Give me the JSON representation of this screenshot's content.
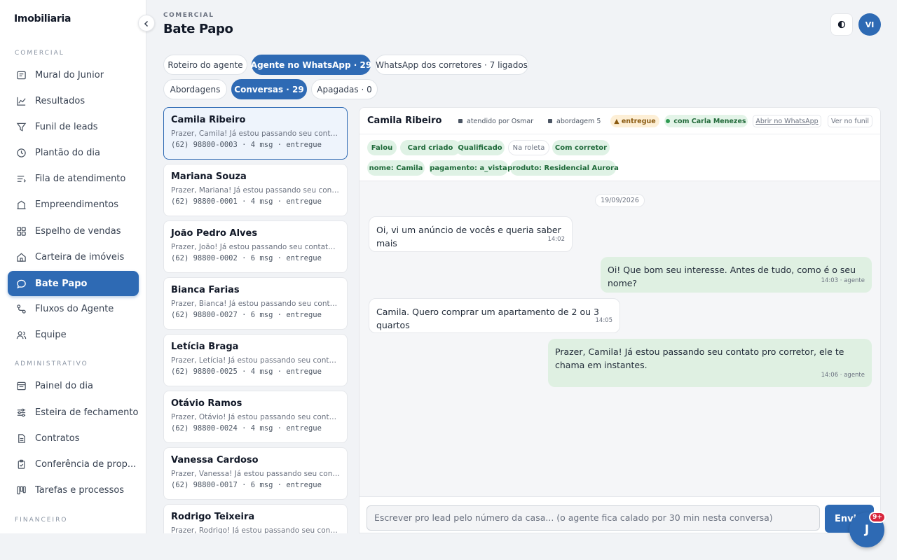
{
  "sidebar": {
    "brand": "Imobiliaria",
    "sections": {
      "comercial": "COMERCIAL",
      "administrativo": "ADMINISTRATIVO",
      "financeiro": "FINANCEIRO"
    },
    "items": [
      {
        "label": "Mural do Junior",
        "icon": "board-icon"
      },
      {
        "label": "Resultados",
        "icon": "chart-line-icon"
      },
      {
        "label": "Funil de leads",
        "icon": "funnel-icon"
      },
      {
        "label": "Plantão do dia",
        "icon": "clock-icon"
      },
      {
        "label": "Fila de atendimento",
        "icon": "queue-icon"
      },
      {
        "label": "Empreendimentos",
        "icon": "building-icon"
      },
      {
        "label": "Espelho de vendas",
        "icon": "grid-icon"
      },
      {
        "label": "Carteira de imóveis",
        "icon": "house-icon"
      },
      {
        "label": "Bate Papo",
        "icon": "chat-bubble-icon",
        "active": true
      },
      {
        "label": "Fluxos do Agente",
        "icon": "flow-icon"
      },
      {
        "label": "Equipe",
        "icon": "users-icon"
      },
      {
        "label": "Painel do dia",
        "icon": "panel-icon"
      },
      {
        "label": "Esteira de fechamento",
        "icon": "sliders-icon"
      },
      {
        "label": "Contratos",
        "icon": "document-icon"
      },
      {
        "label": "Conferência de prop...",
        "icon": "clipboard-check-icon"
      },
      {
        "label": "Tarefas e processos",
        "icon": "kanban-icon"
      }
    ]
  },
  "header": {
    "eyebrow": "COMERCIAL",
    "title": "Bate Papo",
    "avatar": "VI"
  },
  "tabs_top": [
    {
      "label": "Roteiro do agente"
    },
    {
      "label": "Agente no WhatsApp · 29",
      "active": true
    },
    {
      "label": "WhatsApp dos corretores · 7 ligados"
    }
  ],
  "tabs_sub": [
    {
      "label": "Abordagens"
    },
    {
      "label": "Conversas · 29",
      "active": true
    },
    {
      "label": "Apagadas · 0"
    }
  ],
  "conversations": [
    {
      "name": "Camila Ribeiro",
      "preview": "Prazer, Camila! Já estou passando seu contato pro corretor, ele te chama em instantes.",
      "meta": "(62) 98800-0003 · 4 msg · entregue",
      "selected": true
    },
    {
      "name": "Mariana Souza",
      "preview": "Prazer, Mariana! Já estou passando seu contato pro corretor, ele te chama em instantes.",
      "meta": "(62) 98800-0001 · 4 msg · entregue"
    },
    {
      "name": "João Pedro Alves",
      "preview": "Prazer, João! Já estou passando seu contato pro corretor, ele te chama em instantes.",
      "meta": "(62) 98800-0002 · 6 msg · entregue"
    },
    {
      "name": "Bianca Farias",
      "preview": "Prazer, Bianca! Já estou passando seu contato pro corretor, ele te chama em instantes.",
      "meta": "(62) 98800-0027 · 6 msg · entregue"
    },
    {
      "name": "Letícia Braga",
      "preview": "Prazer, Letícia! Já estou passando seu contato pro corretor, ele te chama em instantes.",
      "meta": "(62) 98800-0025 · 4 msg · entregue"
    },
    {
      "name": "Otávio Ramos",
      "preview": "Prazer, Otávio! Já estou passando seu contato pro corretor, ele te chama em instantes.",
      "meta": "(62) 98800-0024 · 4 msg · entregue"
    },
    {
      "name": "Vanessa Cardoso",
      "preview": "Prazer, Vanessa! Já estou passando seu contato pro corretor, ele te chama em instantes.",
      "meta": "(62) 98800-0017 · 6 msg · entregue"
    },
    {
      "name": "Rodrigo Teixeira",
      "preview": "Prazer, Rodrigo! Já estou passando seu contato pro corretor, ele te chama em instantes.",
      "meta": ""
    }
  ],
  "chat": {
    "name": "Camila Ribeiro",
    "attended_by": "atendido por Osmar",
    "approach": "abordagem 5",
    "status": "▲ entregue",
    "with": "com Carla Menezes",
    "open_whatsapp": "Abrir no WhatsApp",
    "view_funnel": "Ver no funil",
    "tags": [
      {
        "label": "Falou"
      },
      {
        "label": "Card criado"
      },
      {
        "label": "Qualificado"
      },
      {
        "label": "Na roleta",
        "muted": true
      },
      {
        "label": "Com corretor"
      },
      {
        "label": "nome: Camila"
      },
      {
        "label": "pagamento: a_vista"
      },
      {
        "label": "produto: Residencial Aurora"
      }
    ],
    "date": "19/09/2026",
    "messages": [
      {
        "dir": "in",
        "text": "Oi, vi um anúncio de vocês e queria saber mais",
        "time": "14:02"
      },
      {
        "dir": "out",
        "text": "Oi! Que bom seu interesse. Antes de tudo, como é o seu nome?",
        "time": "14:03 · agente"
      },
      {
        "dir": "in",
        "text": "Camila. Quero comprar um apartamento de 2 ou 3 quartos",
        "time": "14:05"
      },
      {
        "dir": "out",
        "text": "Prazer, Camila! Já estou passando seu contato pro corretor, ele te chama em instantes.",
        "time": "14:06 · agente"
      }
    ],
    "composer_placeholder": "Escrever pro lead pelo número da casa... (o agente fica calado por 30 min nesta conversa)",
    "send_label": "Enviar"
  },
  "fab": {
    "label": "J",
    "badge": "9+"
  },
  "colors": {
    "accent": "#2e6ab4",
    "bubble_out": "#dff0e2",
    "tag_green": "#dff2e5",
    "badge": "#d7263d"
  }
}
